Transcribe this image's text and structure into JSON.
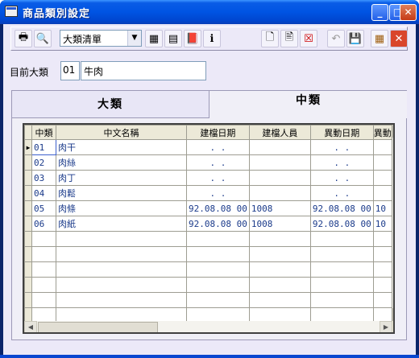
{
  "window": {
    "title": "商品類別設定"
  },
  "toolbar": {
    "category_select": "大類清單"
  },
  "current_category": {
    "label": "目前大類",
    "code": "01",
    "name": "牛肉"
  },
  "tabs": [
    {
      "label": "大類"
    },
    {
      "label": "中類"
    }
  ],
  "grid": {
    "columns": [
      "中類",
      "中文名稱",
      "建檔日期",
      "建檔人員",
      "異動日期",
      "異動"
    ],
    "rows": [
      [
        "01",
        "肉干",
        ". .",
        "",
        ". .",
        ""
      ],
      [
        "02",
        "肉絲",
        ". .",
        "",
        ". .",
        ""
      ],
      [
        "03",
        "肉丁",
        ". .",
        "",
        ". .",
        ""
      ],
      [
        "04",
        "肉鬆",
        ". .",
        "",
        ". .",
        ""
      ],
      [
        "05",
        "肉條",
        "92.08.08 00",
        "1008",
        "92.08.08 00",
        "10"
      ],
      [
        "06",
        "肉紙",
        "92.08.08 00",
        "1008",
        "92.08.08 00",
        "10"
      ]
    ]
  }
}
